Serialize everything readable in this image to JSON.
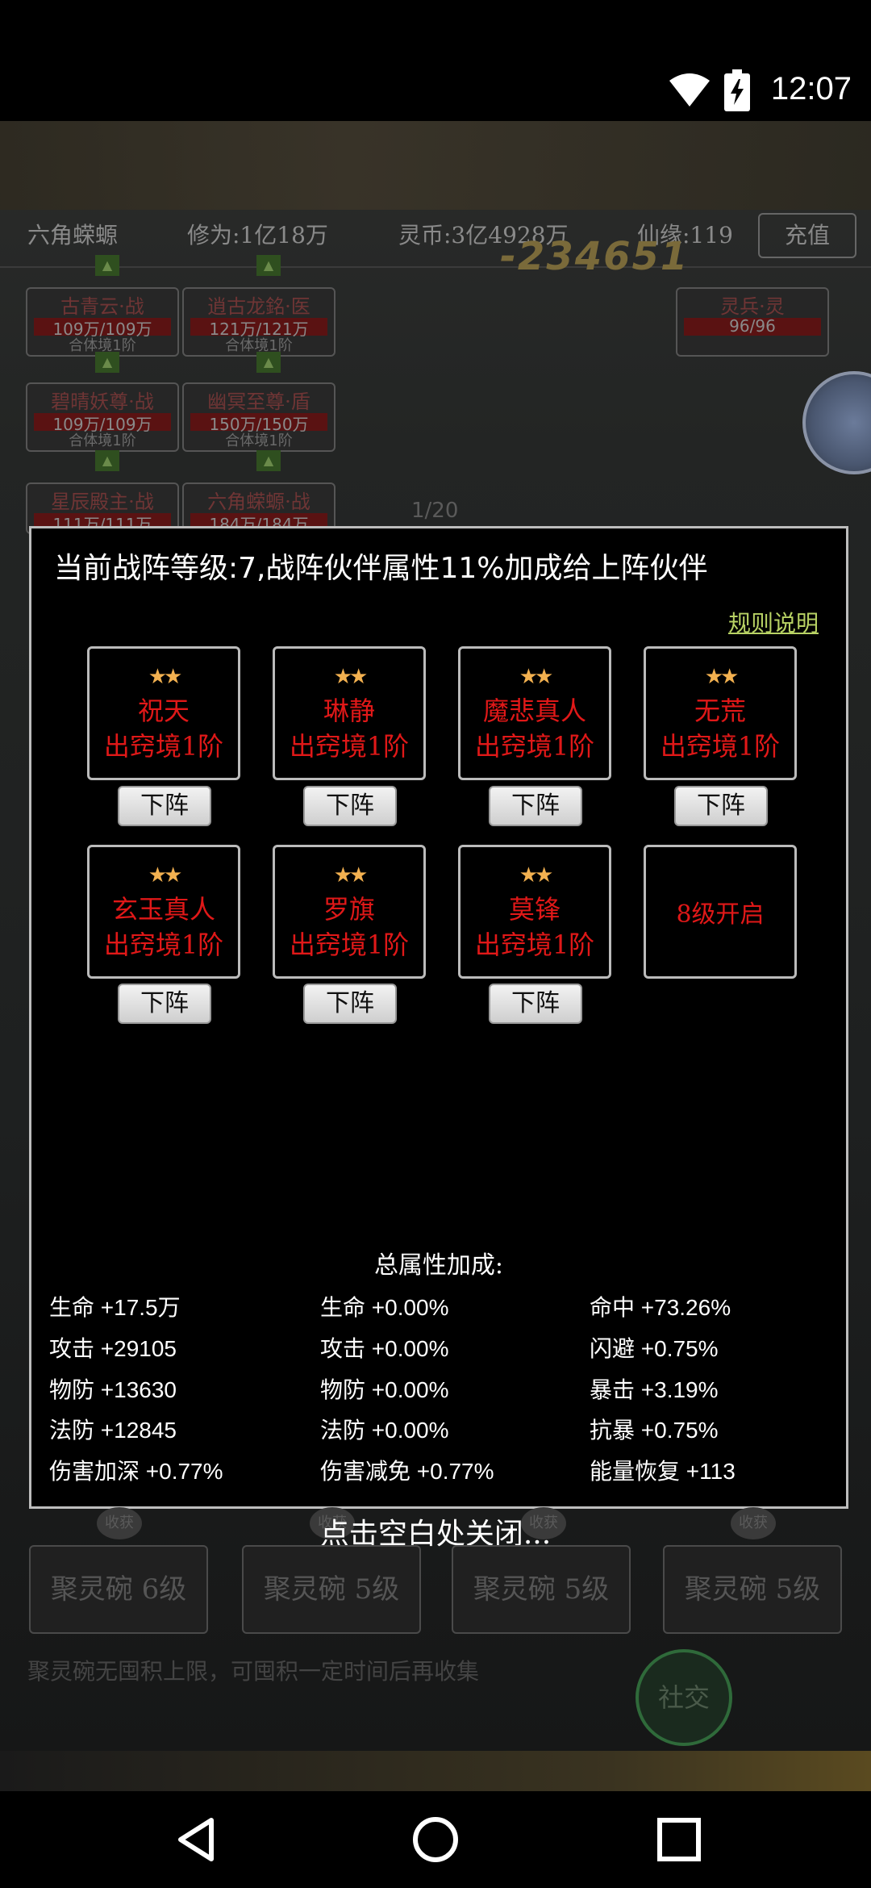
{
  "status_bar": {
    "time": "12:07"
  },
  "top_info": {
    "player_name": "六角蝾螈",
    "cultivation": "修为:1亿18万",
    "spirit_coins": "灵币:3亿4928万",
    "immortal_fate": "仙缘:119",
    "recharge": "充值"
  },
  "damage_number": "-234651",
  "battle_units": [
    {
      "name": "古青云·战",
      "hp": "109万/109万",
      "sub": "合体境1阶"
    },
    {
      "name": "逍古龙銘·医",
      "hp": "121万/121万",
      "sub": "合体境1阶"
    },
    {
      "name": "碧晴妖尊·战",
      "hp": "109万/109万",
      "sub": "合体境1阶"
    },
    {
      "name": "幽冥至尊·盾",
      "hp": "150万/150万",
      "sub": "合体境1阶"
    },
    {
      "name": "星辰殿主·战",
      "hp": "111万/111万",
      "sub": ""
    },
    {
      "name": "六角蝾螈·战",
      "hp": "184万/184万",
      "sub": ""
    }
  ],
  "spirit_soldier": {
    "name": "灵兵·灵",
    "hp": "96/96"
  },
  "page_indicator": "1/20",
  "modal": {
    "title": "当前战阵等级:7,战阵伙伴属性11%加成给上阵伙伴",
    "rules_link": "规则说明",
    "slots": [
      {
        "stars": "★★",
        "name": "祝天",
        "realm": "出窍境1阶",
        "button": "下阵"
      },
      {
        "stars": "★★",
        "name": "琳静",
        "realm": "出窍境1阶",
        "button": "下阵"
      },
      {
        "stars": "★★",
        "name": "魔悲真人",
        "realm": "出窍境1阶",
        "button": "下阵"
      },
      {
        "stars": "★★",
        "name": "无荒",
        "realm": "出窍境1阶",
        "button": "下阵"
      },
      {
        "stars": "★★",
        "name": "玄玉真人",
        "realm": "出窍境1阶",
        "button": "下阵"
      },
      {
        "stars": "★★",
        "name": "罗旗",
        "realm": "出窍境1阶",
        "button": "下阵"
      },
      {
        "stars": "★★",
        "name": "莫锋",
        "realm": "出窍境1阶",
        "button": "下阵"
      }
    ],
    "locked_slot": "8级开启",
    "total_label": "总属性加成:",
    "stats_col1": [
      "生命 +17.5万",
      "攻击 +29105",
      "物防 +13630",
      "法防 +12845",
      "伤害加深 +0.77%"
    ],
    "stats_col2": [
      "生命 +0.00%",
      "攻击 +0.00%",
      "物防 +0.00%",
      "法防 +0.00%",
      "伤害减免 +0.77%"
    ],
    "stats_col3": [
      "命中 +73.26%",
      "闪避 +0.75%",
      "暴击 +3.19%",
      "抗暴 +0.75%",
      "能量恢复 +113"
    ]
  },
  "close_hint": "点击空白处关闭...",
  "bowls": [
    {
      "label": "聚灵碗 6级",
      "tag": "收获"
    },
    {
      "label": "聚灵碗 5级",
      "tag": "收获"
    },
    {
      "label": "聚灵碗 5级",
      "tag": "收获"
    },
    {
      "label": "聚灵碗 5级",
      "tag": "收获"
    }
  ],
  "bowl_hint": "聚灵碗无囤积上限，可囤积一定时间后再收集",
  "social_button": "社交",
  "icons": {
    "wifi": "wifi-icon",
    "battery": "battery-icon",
    "back": "back-icon",
    "home": "home-icon",
    "recents": "recents-icon"
  }
}
